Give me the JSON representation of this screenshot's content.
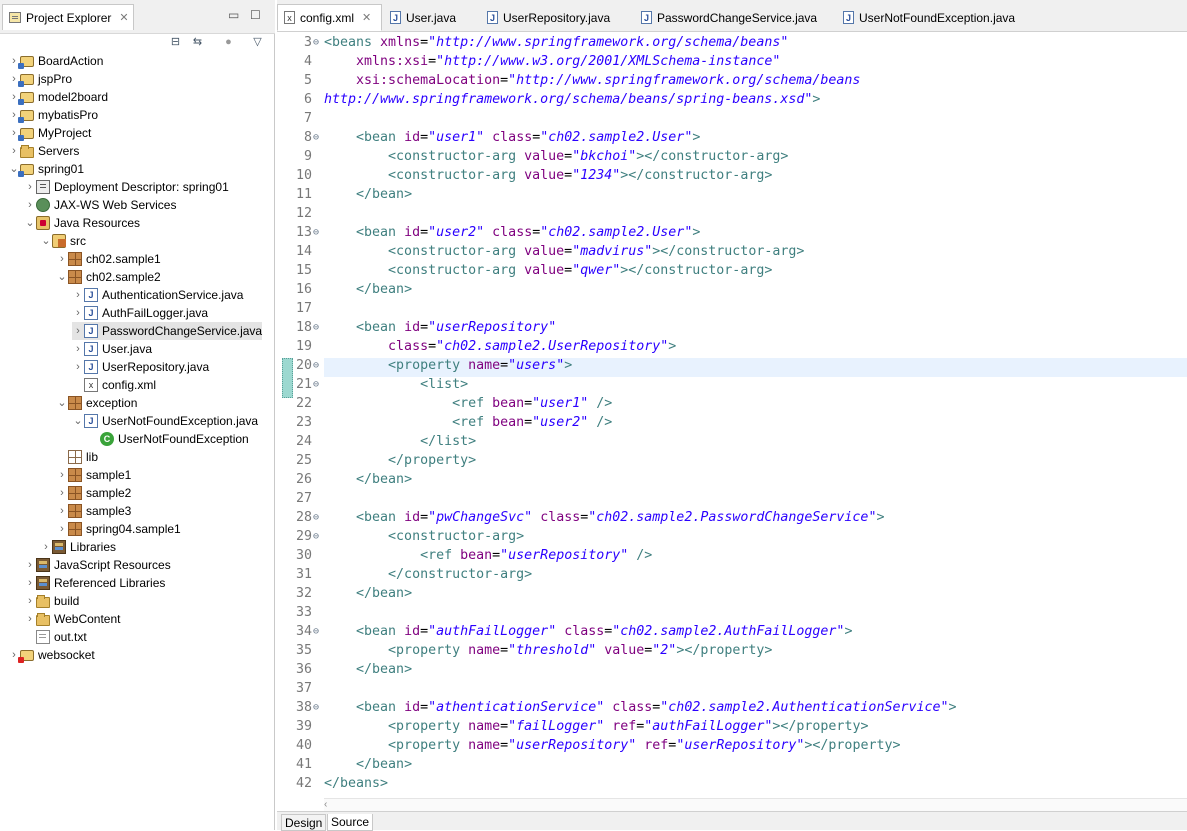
{
  "explorer": {
    "title": "Project Explorer",
    "tree": [
      {
        "label": "BoardAction",
        "icon": "project-icon",
        "tw": "›",
        "indent": 0
      },
      {
        "label": "jspPro",
        "icon": "project-icon",
        "tw": "›",
        "indent": 0
      },
      {
        "label": "model2board",
        "icon": "project-icon",
        "tw": "›",
        "indent": 0
      },
      {
        "label": "mybatisPro",
        "icon": "project-icon",
        "tw": "›",
        "indent": 0
      },
      {
        "label": "MyProject",
        "icon": "project-icon",
        "tw": "›",
        "indent": 0
      },
      {
        "label": "Servers",
        "icon": "folder-icon",
        "tw": "›",
        "indent": 0
      },
      {
        "label": "spring01",
        "icon": "project-icon",
        "tw": "⌄",
        "indent": 0
      },
      {
        "label": "Deployment Descriptor: spring01",
        "icon": "deployment-descriptor-icon",
        "tw": "›",
        "indent": 1
      },
      {
        "label": "JAX-WS Web Services",
        "icon": "web-services-icon",
        "tw": "›",
        "indent": 1
      },
      {
        "label": "Java Resources",
        "icon": "java-resources-icon",
        "tw": "⌄",
        "indent": 1
      },
      {
        "label": "src",
        "icon": "source-folder-icon",
        "tw": "⌄",
        "indent": 2
      },
      {
        "label": "ch02.sample1",
        "icon": "package-icon",
        "tw": "›",
        "indent": 3
      },
      {
        "label": "ch02.sample2",
        "icon": "package-icon",
        "tw": "⌄",
        "indent": 3
      },
      {
        "label": "AuthenticationService.java",
        "icon": "java-file-icon",
        "tw": "›",
        "indent": 4
      },
      {
        "label": "AuthFailLogger.java",
        "icon": "java-file-icon",
        "tw": "›",
        "indent": 4
      },
      {
        "label": "PasswordChangeService.java",
        "icon": "java-file-icon",
        "tw": "›",
        "indent": 4,
        "selected": true
      },
      {
        "label": "User.java",
        "icon": "java-file-icon",
        "tw": "›",
        "indent": 4
      },
      {
        "label": "UserRepository.java",
        "icon": "java-file-icon",
        "tw": "›",
        "indent": 4
      },
      {
        "label": "config.xml",
        "icon": "xml-file-icon",
        "tw": "",
        "indent": 4
      },
      {
        "label": "exception",
        "icon": "package-icon",
        "tw": "⌄",
        "indent": 3
      },
      {
        "label": "UserNotFoundException.java",
        "icon": "java-file-icon",
        "tw": "⌄",
        "indent": 4
      },
      {
        "label": "UserNotFoundException",
        "icon": "class-icon",
        "tw": "",
        "indent": 5
      },
      {
        "label": "lib",
        "icon": "empty-package-icon",
        "tw": "",
        "indent": 3
      },
      {
        "label": "sample1",
        "icon": "package-icon",
        "tw": "›",
        "indent": 3
      },
      {
        "label": "sample2",
        "icon": "package-icon",
        "tw": "›",
        "indent": 3
      },
      {
        "label": "sample3",
        "icon": "package-icon",
        "tw": "›",
        "indent": 3
      },
      {
        "label": "spring04.sample1",
        "icon": "package-icon",
        "tw": "›",
        "indent": 3
      },
      {
        "label": "Libraries",
        "icon": "libraries-icon",
        "tw": "›",
        "indent": 2
      },
      {
        "label": "JavaScript Resources",
        "icon": "javascript-resources-icon",
        "tw": "›",
        "indent": 1
      },
      {
        "label": "Referenced Libraries",
        "icon": "libraries-icon",
        "tw": "›",
        "indent": 1
      },
      {
        "label": "build",
        "icon": "folder-icon",
        "tw": "›",
        "indent": 1
      },
      {
        "label": "WebContent",
        "icon": "folder-icon",
        "tw": "›",
        "indent": 1
      },
      {
        "label": "out.txt",
        "icon": "text-file-icon",
        "tw": "",
        "indent": 1
      },
      {
        "label": "websocket",
        "icon": "project-error-icon",
        "tw": "›",
        "indent": 0
      }
    ]
  },
  "editor": {
    "tabs": [
      {
        "label": "config.xml",
        "icon": "xml-file-icon",
        "active": true
      },
      {
        "label": "User.java",
        "icon": "java-file-icon"
      },
      {
        "label": "UserRepository.java",
        "icon": "java-file-icon"
      },
      {
        "label": "PasswordChangeService.java",
        "icon": "java-file-icon"
      },
      {
        "label": "UserNotFoundException.java",
        "icon": "java-file-icon"
      }
    ],
    "bottom_tabs": [
      {
        "label": "Design"
      },
      {
        "label": "Source",
        "active": true
      }
    ],
    "current_line": 20,
    "lines": [
      {
        "n": "3",
        "fold": true,
        "tokens": [
          [
            "t",
            "<beans "
          ],
          [
            "a",
            "xmlns"
          ],
          [
            "p",
            "="
          ],
          [
            "v",
            "\"http://www.springframework.org/schema/beans\""
          ]
        ]
      },
      {
        "n": "4",
        "tokens": [
          [
            "p",
            "    "
          ],
          [
            "a",
            "xmlns:xsi"
          ],
          [
            "p",
            "="
          ],
          [
            "v",
            "\"http://www.w3.org/2001/XMLSchema-instance\""
          ]
        ]
      },
      {
        "n": "5",
        "tokens": [
          [
            "p",
            "    "
          ],
          [
            "a",
            "xsi:schemaLocation"
          ],
          [
            "p",
            "="
          ],
          [
            "v",
            "\"http://www.springframework.org/schema/beans"
          ]
        ]
      },
      {
        "n": "6",
        "tokens": [
          [
            "v",
            "http://www.springframework.org/schema/beans/spring-beans.xsd\""
          ],
          [
            "t",
            ">"
          ]
        ]
      },
      {
        "n": "7",
        "tokens": []
      },
      {
        "n": "8",
        "fold": true,
        "tokens": [
          [
            "p",
            "    "
          ],
          [
            "t",
            "<bean "
          ],
          [
            "a",
            "id"
          ],
          [
            "p",
            "="
          ],
          [
            "v",
            "\"user1\""
          ],
          [
            "p",
            " "
          ],
          [
            "a",
            "class"
          ],
          [
            "p",
            "="
          ],
          [
            "v",
            "\"ch02.sample2.User\""
          ],
          [
            "t",
            ">"
          ]
        ]
      },
      {
        "n": "9",
        "tokens": [
          [
            "p",
            "        "
          ],
          [
            "t",
            "<constructor-arg "
          ],
          [
            "a",
            "value"
          ],
          [
            "p",
            "="
          ],
          [
            "v",
            "\"bkchoi\""
          ],
          [
            "t",
            "></constructor-arg>"
          ]
        ]
      },
      {
        "n": "10",
        "tokens": [
          [
            "p",
            "        "
          ],
          [
            "t",
            "<constructor-arg "
          ],
          [
            "a",
            "value"
          ],
          [
            "p",
            "="
          ],
          [
            "v",
            "\"1234\""
          ],
          [
            "t",
            "></constructor-arg>"
          ]
        ]
      },
      {
        "n": "11",
        "tokens": [
          [
            "p",
            "    "
          ],
          [
            "t",
            "</bean>"
          ]
        ]
      },
      {
        "n": "12",
        "tokens": []
      },
      {
        "n": "13",
        "fold": true,
        "tokens": [
          [
            "p",
            "    "
          ],
          [
            "t",
            "<bean "
          ],
          [
            "a",
            "id"
          ],
          [
            "p",
            "="
          ],
          [
            "v",
            "\"user2\""
          ],
          [
            "p",
            " "
          ],
          [
            "a",
            "class"
          ],
          [
            "p",
            "="
          ],
          [
            "v",
            "\"ch02.sample2.User\""
          ],
          [
            "t",
            ">"
          ]
        ]
      },
      {
        "n": "14",
        "tokens": [
          [
            "p",
            "        "
          ],
          [
            "t",
            "<constructor-arg "
          ],
          [
            "a",
            "value"
          ],
          [
            "p",
            "="
          ],
          [
            "v",
            "\"madvirus\""
          ],
          [
            "t",
            "></constructor-arg>"
          ]
        ]
      },
      {
        "n": "15",
        "tokens": [
          [
            "p",
            "        "
          ],
          [
            "t",
            "<constructor-arg "
          ],
          [
            "a",
            "value"
          ],
          [
            "p",
            "="
          ],
          [
            "v",
            "\"qwer\""
          ],
          [
            "t",
            "></constructor-arg>"
          ]
        ]
      },
      {
        "n": "16",
        "tokens": [
          [
            "p",
            "    "
          ],
          [
            "t",
            "</bean>"
          ]
        ]
      },
      {
        "n": "17",
        "tokens": []
      },
      {
        "n": "18",
        "fold": true,
        "tokens": [
          [
            "p",
            "    "
          ],
          [
            "t",
            "<bean "
          ],
          [
            "a",
            "id"
          ],
          [
            "p",
            "="
          ],
          [
            "v",
            "\"userRepository\""
          ]
        ]
      },
      {
        "n": "19",
        "tokens": [
          [
            "p",
            "        "
          ],
          [
            "a",
            "class"
          ],
          [
            "p",
            "="
          ],
          [
            "v",
            "\"ch02.sample2.UserRepository\""
          ],
          [
            "t",
            ">"
          ]
        ]
      },
      {
        "n": "20",
        "fold": true,
        "tokens": [
          [
            "p",
            "        "
          ],
          [
            "t",
            "<property "
          ],
          [
            "a",
            "name"
          ],
          [
            "p",
            "="
          ],
          [
            "v",
            "\"users\""
          ],
          [
            "t",
            ">"
          ]
        ]
      },
      {
        "n": "21",
        "fold": true,
        "tokens": [
          [
            "p",
            "            "
          ],
          [
            "t",
            "<list>"
          ]
        ]
      },
      {
        "n": "22",
        "tokens": [
          [
            "p",
            "                "
          ],
          [
            "t",
            "<ref "
          ],
          [
            "a",
            "bean"
          ],
          [
            "p",
            "="
          ],
          [
            "v",
            "\"user1\""
          ],
          [
            "p",
            " "
          ],
          [
            "t",
            "/>"
          ]
        ]
      },
      {
        "n": "23",
        "tokens": [
          [
            "p",
            "                "
          ],
          [
            "t",
            "<ref "
          ],
          [
            "a",
            "bean"
          ],
          [
            "p",
            "="
          ],
          [
            "v",
            "\"user2\""
          ],
          [
            "p",
            " "
          ],
          [
            "t",
            "/>"
          ]
        ]
      },
      {
        "n": "24",
        "tokens": [
          [
            "p",
            "            "
          ],
          [
            "t",
            "</list>"
          ]
        ]
      },
      {
        "n": "25",
        "tokens": [
          [
            "p",
            "        "
          ],
          [
            "t",
            "</property>"
          ]
        ]
      },
      {
        "n": "26",
        "tokens": [
          [
            "p",
            "    "
          ],
          [
            "t",
            "</bean>"
          ]
        ]
      },
      {
        "n": "27",
        "tokens": []
      },
      {
        "n": "28",
        "fold": true,
        "tokens": [
          [
            "p",
            "    "
          ],
          [
            "t",
            "<bean "
          ],
          [
            "a",
            "id"
          ],
          [
            "p",
            "="
          ],
          [
            "v",
            "\"pwChangeSvc\""
          ],
          [
            "p",
            " "
          ],
          [
            "a",
            "class"
          ],
          [
            "p",
            "="
          ],
          [
            "v",
            "\"ch02.sample2.PasswordChangeService\""
          ],
          [
            "t",
            ">"
          ]
        ]
      },
      {
        "n": "29",
        "fold": true,
        "tokens": [
          [
            "p",
            "        "
          ],
          [
            "t",
            "<constructor-arg>"
          ]
        ]
      },
      {
        "n": "30",
        "tokens": [
          [
            "p",
            "            "
          ],
          [
            "t",
            "<ref "
          ],
          [
            "a",
            "bean"
          ],
          [
            "p",
            "="
          ],
          [
            "v",
            "\"userRepository\""
          ],
          [
            "p",
            " "
          ],
          [
            "t",
            "/>"
          ]
        ]
      },
      {
        "n": "31",
        "tokens": [
          [
            "p",
            "        "
          ],
          [
            "t",
            "</constructor-arg>"
          ]
        ]
      },
      {
        "n": "32",
        "tokens": [
          [
            "p",
            "    "
          ],
          [
            "t",
            "</bean>"
          ]
        ]
      },
      {
        "n": "33",
        "tokens": []
      },
      {
        "n": "34",
        "fold": true,
        "tokens": [
          [
            "p",
            "    "
          ],
          [
            "t",
            "<bean "
          ],
          [
            "a",
            "id"
          ],
          [
            "p",
            "="
          ],
          [
            "v",
            "\"authFailLogger\""
          ],
          [
            "p",
            " "
          ],
          [
            "a",
            "class"
          ],
          [
            "p",
            "="
          ],
          [
            "v",
            "\"ch02.sample2.AuthFailLogger\""
          ],
          [
            "t",
            ">"
          ]
        ]
      },
      {
        "n": "35",
        "tokens": [
          [
            "p",
            "        "
          ],
          [
            "t",
            "<property "
          ],
          [
            "a",
            "name"
          ],
          [
            "p",
            "="
          ],
          [
            "v",
            "\"threshold\""
          ],
          [
            "p",
            " "
          ],
          [
            "a",
            "value"
          ],
          [
            "p",
            "="
          ],
          [
            "v",
            "\"2\""
          ],
          [
            "t",
            "></property>"
          ]
        ]
      },
      {
        "n": "36",
        "tokens": [
          [
            "p",
            "    "
          ],
          [
            "t",
            "</bean>"
          ]
        ]
      },
      {
        "n": "37",
        "tokens": []
      },
      {
        "n": "38",
        "fold": true,
        "tokens": [
          [
            "p",
            "    "
          ],
          [
            "t",
            "<bean "
          ],
          [
            "a",
            "id"
          ],
          [
            "p",
            "="
          ],
          [
            "v",
            "\"athenticationService\""
          ],
          [
            "p",
            " "
          ],
          [
            "a",
            "class"
          ],
          [
            "p",
            "="
          ],
          [
            "v",
            "\"ch02.sample2.AuthenticationService\""
          ],
          [
            "t",
            ">"
          ]
        ]
      },
      {
        "n": "39",
        "tokens": [
          [
            "p",
            "        "
          ],
          [
            "t",
            "<property "
          ],
          [
            "a",
            "name"
          ],
          [
            "p",
            "="
          ],
          [
            "v",
            "\"failLogger\""
          ],
          [
            "p",
            " "
          ],
          [
            "a",
            "ref"
          ],
          [
            "p",
            "="
          ],
          [
            "v",
            "\"authFailLogger\""
          ],
          [
            "t",
            "></property>"
          ]
        ]
      },
      {
        "n": "40",
        "tokens": [
          [
            "p",
            "        "
          ],
          [
            "t",
            "<property "
          ],
          [
            "a",
            "name"
          ],
          [
            "p",
            "="
          ],
          [
            "v",
            "\"userRepository\""
          ],
          [
            "p",
            " "
          ],
          [
            "a",
            "ref"
          ],
          [
            "p",
            "="
          ],
          [
            "v",
            "\"userRepository\""
          ],
          [
            "t",
            "></property>"
          ]
        ]
      },
      {
        "n": "41",
        "tokens": [
          [
            "p",
            "    "
          ],
          [
            "t",
            "</bean>"
          ]
        ]
      },
      {
        "n": "42",
        "tokens": [
          [
            "t",
            "</beans>"
          ]
        ]
      }
    ]
  }
}
